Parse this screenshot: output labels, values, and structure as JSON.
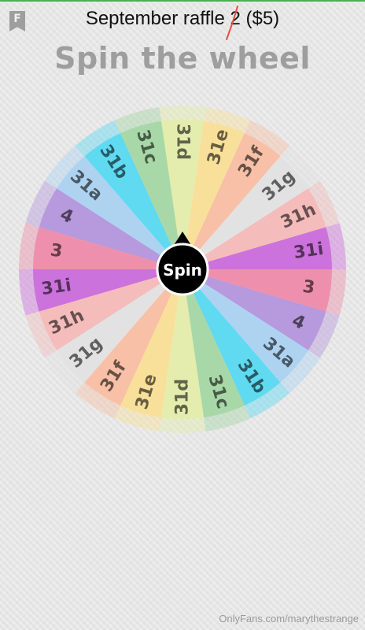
{
  "header": {
    "badge_letter": "F",
    "title": "September raffle 2 ($5)",
    "headline": "Spin the wheel"
  },
  "wheel": {
    "spin_label": "Spin",
    "segments": [
      {
        "label": "31d",
        "color": "#e4edae"
      },
      {
        "label": "31e",
        "color": "#f9e09a"
      },
      {
        "label": "31f",
        "color": "#f8c0a6"
      },
      {
        "label": "31g",
        "color": "#e2e2e2"
      },
      {
        "label": "31h",
        "color": "#f5bcbc"
      },
      {
        "label": "31i",
        "color": "#cc72dc"
      },
      {
        "label": "3",
        "color": "#ee90ad"
      },
      {
        "label": "4",
        "color": "#b799dd"
      },
      {
        "label": "31a",
        "color": "#aed3f1"
      },
      {
        "label": "31b",
        "color": "#5fdaf1"
      },
      {
        "label": "31c",
        "color": "#a8d8a8"
      },
      {
        "label": "31d",
        "color": "#e4edae"
      },
      {
        "label": "31e",
        "color": "#f9e09a"
      },
      {
        "label": "31f",
        "color": "#f8c0a6"
      },
      {
        "label": "31g",
        "color": "#e2e2e2"
      },
      {
        "label": "31h",
        "color": "#f5bcbc"
      },
      {
        "label": "31i",
        "color": "#cc72dc"
      },
      {
        "label": "3",
        "color": "#ee90ad"
      },
      {
        "label": "4",
        "color": "#b799dd"
      },
      {
        "label": "31a",
        "color": "#aed3f1"
      },
      {
        "label": "31b",
        "color": "#5fdaf1"
      },
      {
        "label": "31c",
        "color": "#a8d8a8"
      }
    ]
  },
  "footer": {
    "watermark": "OnlyFans.com/marythestrange"
  }
}
